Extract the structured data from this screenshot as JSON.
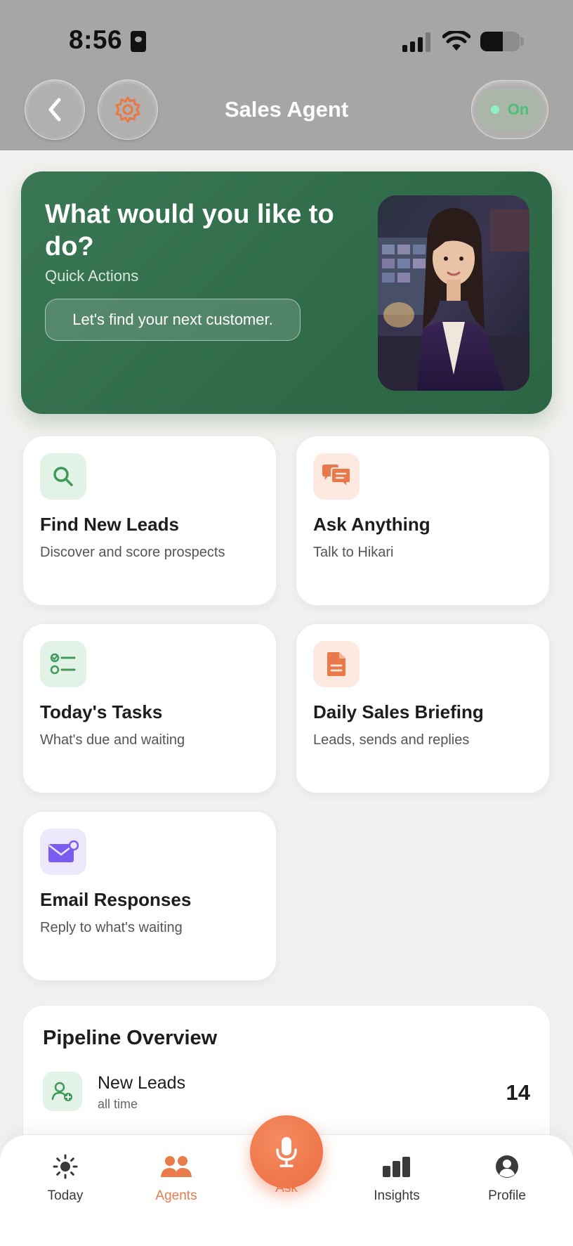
{
  "status_bar": {
    "time": "8:56"
  },
  "header": {
    "title": "Sales Agent",
    "toggle_label": "On"
  },
  "hero": {
    "title": "What would you like to do?",
    "subtitle": "Quick Actions",
    "chip": "Let's find your next customer."
  },
  "cards": [
    {
      "title": "Find New Leads",
      "subtitle": "Discover and score prospects",
      "icon": "search-icon"
    },
    {
      "title": "Ask Anything",
      "subtitle": "Talk to Hikari",
      "icon": "chat-bubbles-icon"
    },
    {
      "title": "Today's Tasks",
      "subtitle": "What's due and waiting",
      "icon": "checklist-icon"
    },
    {
      "title": "Daily Sales Briefing",
      "subtitle": "Leads, sends and replies",
      "icon": "document-icon"
    },
    {
      "title": "Email Responses",
      "subtitle": "Reply to what's waiting",
      "icon": "envelope-icon"
    }
  ],
  "pipeline": {
    "title": "Pipeline Overview",
    "rows": [
      {
        "label": "New Leads",
        "sublabel": "all time",
        "count": "14",
        "icon": "add-user-icon"
      }
    ]
  },
  "nav": {
    "items": [
      {
        "label": "Today",
        "icon": "sun-icon"
      },
      {
        "label": "Agents",
        "icon": "people-icon",
        "active": true
      },
      {
        "label": "Ask",
        "icon": "microphone-icon"
      },
      {
        "label": "Insights",
        "icon": "bar-chart-icon"
      },
      {
        "label": "Profile",
        "icon": "profile-icon"
      }
    ]
  },
  "colors": {
    "accent": "#ea7b4b",
    "hero_green": "#2f6b48",
    "header_bg": "#a8a6a4"
  }
}
